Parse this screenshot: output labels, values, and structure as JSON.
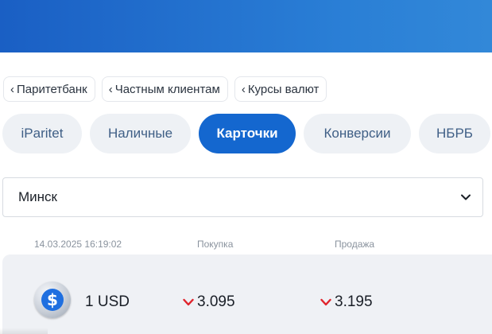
{
  "breadcrumb": [
    {
      "label": "Паритетбанк"
    },
    {
      "label": "Частным клиентам"
    },
    {
      "label": "Курсы валют"
    }
  ],
  "tabs": [
    {
      "label": "iParitet",
      "active": false
    },
    {
      "label": "Наличные",
      "active": false
    },
    {
      "label": "Карточки",
      "active": true
    },
    {
      "label": "Конверсии",
      "active": false
    },
    {
      "label": "НБРБ",
      "active": false
    }
  ],
  "city_select": {
    "value": "Минск"
  },
  "rates_header": {
    "timestamp": "14.03.2025 16:19:02",
    "buy": "Покупка",
    "sell": "Продажа"
  },
  "rates": [
    {
      "currency": "1 USD",
      "buy": "3.095",
      "buy_trend": "down",
      "sell": "3.195",
      "sell_trend": "down"
    }
  ],
  "colors": {
    "brand_blue": "#1467cf",
    "trend_down": "#e0242d"
  },
  "icons": {
    "breadcrumb_chevron": "chevron-left-icon",
    "select_chevron": "chevron-down-icon",
    "coin": "usd-coin-icon",
    "trend": "trend-down-arrow-icon"
  }
}
